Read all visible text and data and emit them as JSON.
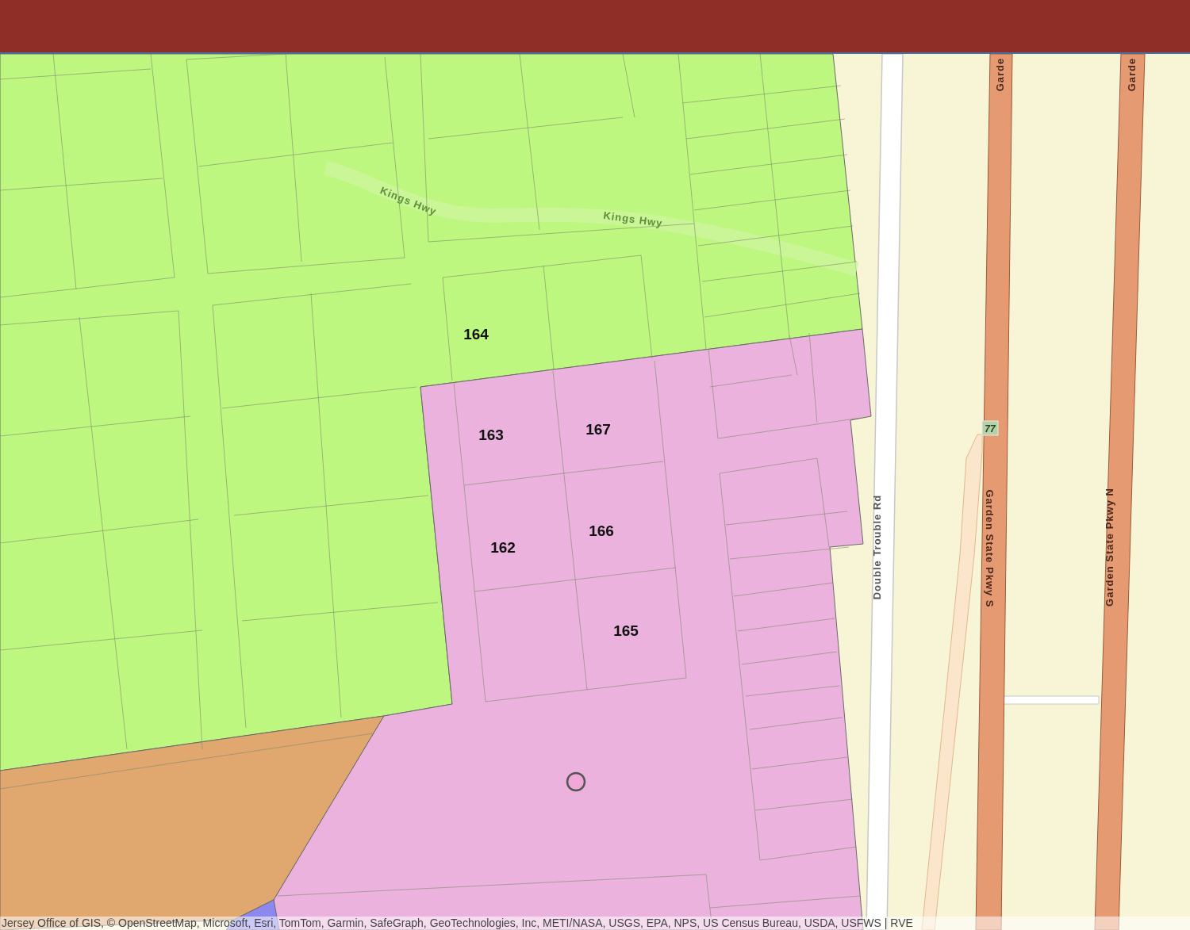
{
  "zones": [
    {
      "color": "#bdf77f"
    },
    {
      "color": "#e0a76f"
    },
    {
      "color": "#eab2dc"
    },
    {
      "color": "#8c88f0"
    }
  ],
  "parcel_labels": [
    "164",
    "163",
    "167",
    "162",
    "166",
    "165"
  ],
  "road_labels": [
    {
      "text": "Kings Hwy",
      "kind": "faint"
    },
    {
      "text": "Kings Hwy",
      "kind": "faint"
    },
    {
      "text": "Double Trouble Rd",
      "kind": "street"
    },
    {
      "text": "Garde",
      "kind": "highway"
    },
    {
      "text": "Garde",
      "kind": "highway"
    },
    {
      "text": "Garden State Pkwy S",
      "kind": "highway"
    },
    {
      "text": "Garden State Pkwy N",
      "kind": "highway"
    }
  ],
  "route_shield": "77",
  "attribution": "Jersey Office of GIS, © OpenStreetMap, Microsoft, Esri, TomTom, Garmin, SafeGraph, GeoTechnologies, Inc, METI/NASA, USGS, EPA, NPS, US Census Bureau, USDA, USFWS | RVE"
}
